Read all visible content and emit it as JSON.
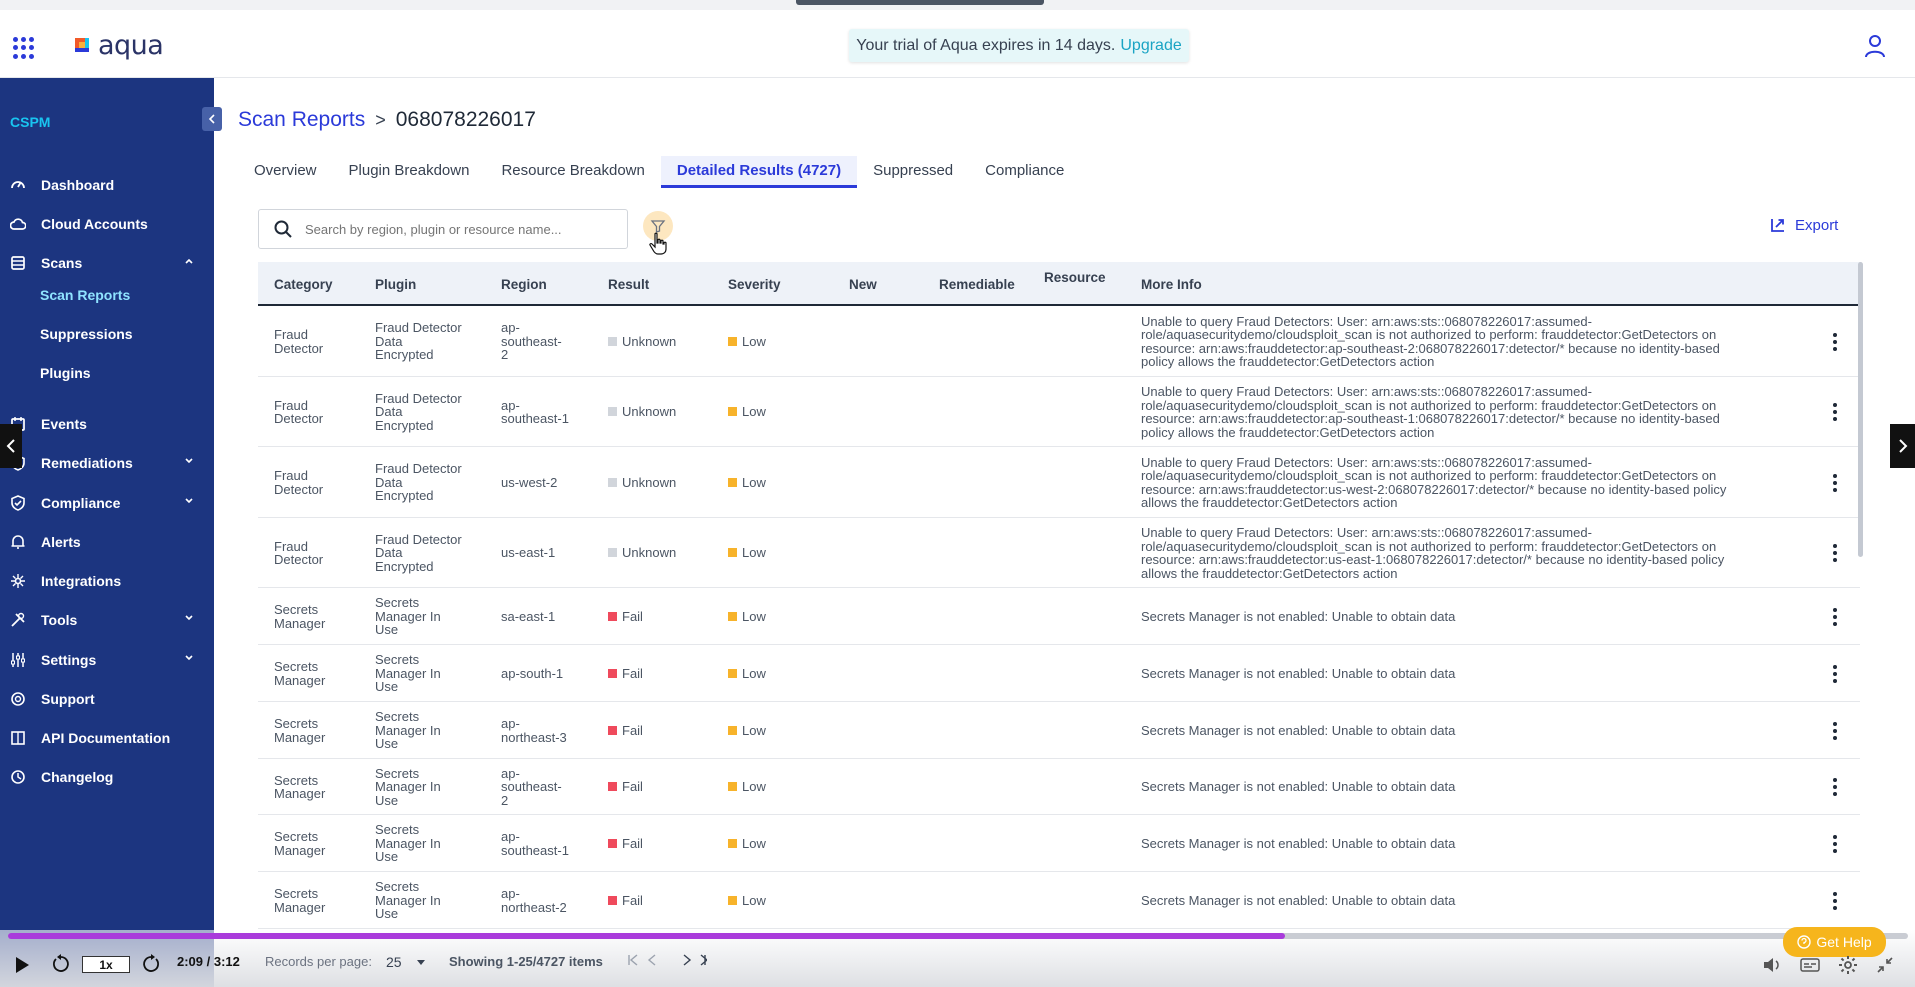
{
  "header": {
    "logo_text": "aqua",
    "trial_text": "Your trial of Aqua expires in 14 days.",
    "trial_link": "Upgrade"
  },
  "sidebar": {
    "section": "CSPM",
    "items": [
      {
        "label": "Dashboard",
        "icon": "dashboard-icon"
      },
      {
        "label": "Cloud Accounts",
        "icon": "cloud-icon"
      },
      {
        "label": "Scans",
        "icon": "scans-icon",
        "expanded": true
      },
      {
        "label": "Events",
        "icon": "events-icon"
      },
      {
        "label": "Remediations",
        "icon": "shield-icon"
      },
      {
        "label": "Compliance",
        "icon": "compliance-icon"
      },
      {
        "label": "Alerts",
        "icon": "bell-icon"
      },
      {
        "label": "Integrations",
        "icon": "integrations-icon"
      },
      {
        "label": "Tools",
        "icon": "tools-icon"
      },
      {
        "label": "Settings",
        "icon": "settings-icon"
      },
      {
        "label": "Support",
        "icon": "support-icon"
      },
      {
        "label": "API Documentation",
        "icon": "book-icon"
      },
      {
        "label": "Changelog",
        "icon": "changelog-icon"
      }
    ],
    "sub_items": [
      "Scan Reports",
      "Suppressions",
      "Plugins"
    ]
  },
  "breadcrumb": {
    "parent": "Scan Reports",
    "sep": ">",
    "current": "068078226017"
  },
  "tabs": [
    "Overview",
    "Plugin Breakdown",
    "Resource Breakdown",
    "Detailed Results (4727)",
    "Suppressed",
    "Compliance"
  ],
  "search": {
    "placeholder": "Search by region, plugin or resource name..."
  },
  "export_label": "Export",
  "table": {
    "columns": [
      "Category",
      "Plugin",
      "Region",
      "Result",
      "Severity",
      "New",
      "Remediable",
      "Resource",
      "More Info"
    ],
    "rows": [
      {
        "category": [
          "Fraud",
          "Detector"
        ],
        "plugin": [
          "Fraud Detector",
          "Data",
          "Encrypted"
        ],
        "region": [
          "ap-",
          "southeast-",
          "2"
        ],
        "result": "Unknown",
        "severity": "Low",
        "info": [
          "Unable to query Fraud Detectors: User: arn:aws:sts::068078226017:assumed-",
          "role/aquasecuritydemo/cloudsploit_scan is not authorized to perform: frauddetector:GetDetectors on",
          "resource: arn:aws:frauddetector:ap-southeast-2:068078226017:detector/* because no identity-based",
          "policy allows the frauddetector:GetDetectors action"
        ]
      },
      {
        "category": [
          "Fraud",
          "Detector"
        ],
        "plugin": [
          "Fraud Detector",
          "Data",
          "Encrypted"
        ],
        "region": [
          "ap-",
          "southeast-1"
        ],
        "result": "Unknown",
        "severity": "Low",
        "info": [
          "Unable to query Fraud Detectors: User: arn:aws:sts::068078226017:assumed-",
          "role/aquasecuritydemo/cloudsploit_scan is not authorized to perform: frauddetector:GetDetectors on",
          "resource: arn:aws:frauddetector:ap-southeast-1:068078226017:detector/* because no identity-based",
          "policy allows the frauddetector:GetDetectors action"
        ]
      },
      {
        "category": [
          "Fraud",
          "Detector"
        ],
        "plugin": [
          "Fraud Detector",
          "Data",
          "Encrypted"
        ],
        "region": [
          "us-west-2"
        ],
        "result": "Unknown",
        "severity": "Low",
        "info": [
          "Unable to query Fraud Detectors: User: arn:aws:sts::068078226017:assumed-",
          "role/aquasecuritydemo/cloudsploit_scan is not authorized to perform: frauddetector:GetDetectors on",
          "resource: arn:aws:frauddetector:us-west-2:068078226017:detector/* because no identity-based policy",
          "allows the frauddetector:GetDetectors action"
        ]
      },
      {
        "category": [
          "Fraud",
          "Detector"
        ],
        "plugin": [
          "Fraud Detector",
          "Data",
          "Encrypted"
        ],
        "region": [
          "us-east-1"
        ],
        "result": "Unknown",
        "severity": "Low",
        "info": [
          "Unable to query Fraud Detectors: User: arn:aws:sts::068078226017:assumed-",
          "role/aquasecuritydemo/cloudsploit_scan is not authorized to perform: frauddetector:GetDetectors on",
          "resource: arn:aws:frauddetector:us-east-1:068078226017:detector/* because no identity-based policy",
          "allows the frauddetector:GetDetectors action"
        ]
      },
      {
        "category": [
          "Secrets",
          "Manager"
        ],
        "plugin": [
          "Secrets",
          "Manager In",
          "Use"
        ],
        "region": [
          "sa-east-1"
        ],
        "result": "Fail",
        "severity": "Low",
        "info": [
          "Secrets Manager is not enabled: Unable to obtain data"
        ]
      },
      {
        "category": [
          "Secrets",
          "Manager"
        ],
        "plugin": [
          "Secrets",
          "Manager In",
          "Use"
        ],
        "region": [
          "ap-south-1"
        ],
        "result": "Fail",
        "severity": "Low",
        "info": [
          "Secrets Manager is not enabled: Unable to obtain data"
        ]
      },
      {
        "category": [
          "Secrets",
          "Manager"
        ],
        "plugin": [
          "Secrets",
          "Manager In",
          "Use"
        ],
        "region": [
          "ap-",
          "northeast-3"
        ],
        "result": "Fail",
        "severity": "Low",
        "info": [
          "Secrets Manager is not enabled: Unable to obtain data"
        ]
      },
      {
        "category": [
          "Secrets",
          "Manager"
        ],
        "plugin": [
          "Secrets",
          "Manager In",
          "Use"
        ],
        "region": [
          "ap-",
          "southeast-",
          "2"
        ],
        "result": "Fail",
        "severity": "Low",
        "info": [
          "Secrets Manager is not enabled: Unable to obtain data"
        ]
      },
      {
        "category": [
          "Secrets",
          "Manager"
        ],
        "plugin": [
          "Secrets",
          "Manager In",
          "Use"
        ],
        "region": [
          "ap-",
          "southeast-1"
        ],
        "result": "Fail",
        "severity": "Low",
        "info": [
          "Secrets Manager is not enabled: Unable to obtain data"
        ]
      },
      {
        "category": [
          "Secrets",
          "Manager"
        ],
        "plugin": [
          "Secrets",
          "Manager In",
          "Use"
        ],
        "region": [
          "ap-",
          "northeast-2"
        ],
        "result": "Fail",
        "severity": "Low",
        "info": [
          "Secrets Manager is not enabled: Unable to obtain data"
        ]
      }
    ]
  },
  "colors": {
    "unknown": "#d1d5db",
    "fail": "#ef4a5c",
    "low": "#f7b32b",
    "brand": "#2b3ad9",
    "sidebar": "#1c3580"
  },
  "player": {
    "speed": "1x",
    "time": "2:09 / 3:12",
    "progress": 0.672,
    "records_label": "Records per page:",
    "records_value": "25",
    "showing": "Showing 1-25/4727 items",
    "help": "Get Help"
  }
}
